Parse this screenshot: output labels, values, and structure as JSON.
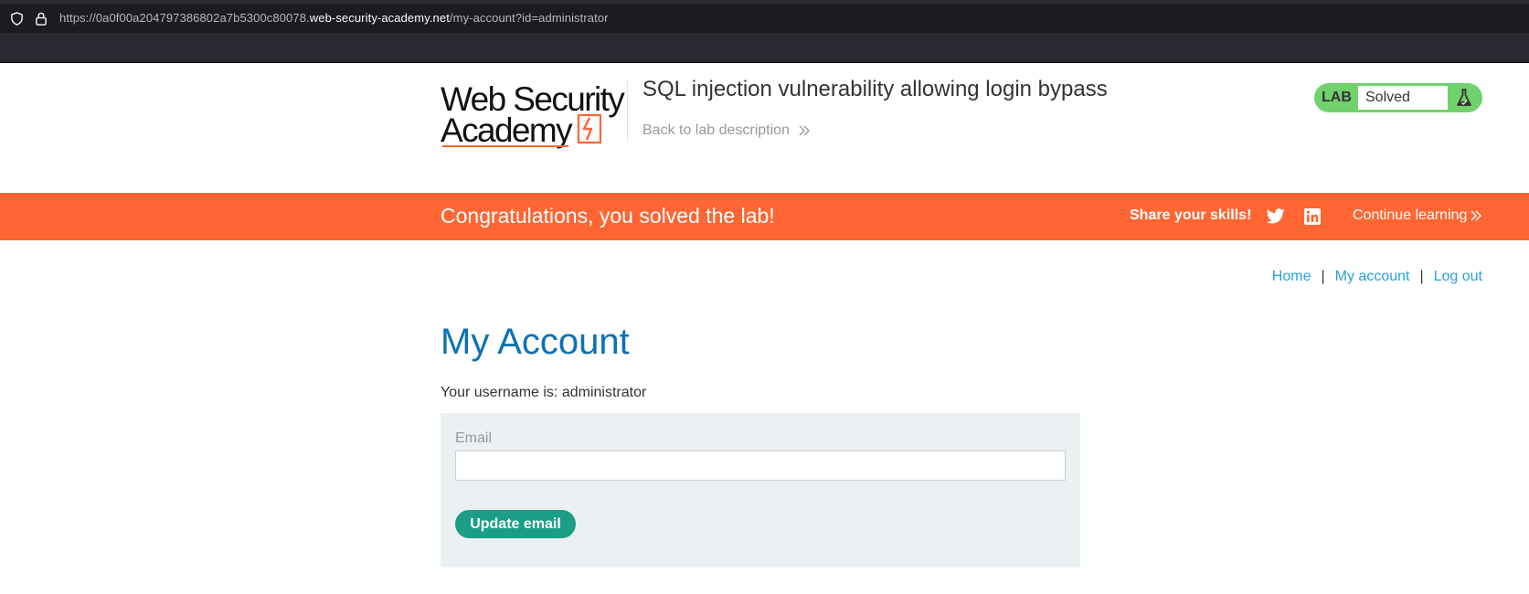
{
  "browser": {
    "url_prefix": "https://0a0f00a204797386802a7b5300c80078.",
    "url_host": "web-security-academy.net",
    "url_path": "/my-account?id=administrator"
  },
  "header": {
    "logo_line1": "Web Security",
    "logo_line2": "Academy",
    "lab_title": "SQL injection vulnerability allowing login bypass",
    "back_link": "Back to lab description",
    "lab_status_label": "LAB",
    "lab_status_value": "Solved"
  },
  "banner": {
    "message": "Congratulations, you solved the lab!",
    "share_label": "Share your skills!",
    "continue_label": "Continue learning"
  },
  "nav": {
    "home": "Home",
    "my_account": "My account",
    "log_out": "Log out",
    "separator": "|"
  },
  "main": {
    "title": "My Account",
    "username_text": "Your username is: administrator",
    "email_label": "Email",
    "email_value": "",
    "update_button": "Update email"
  },
  "colors": {
    "accent_orange": "#ff6633",
    "link_blue": "#29a0dd",
    "title_blue": "#0b71b7",
    "status_green": "#70d16d",
    "button_teal": "#1c9e86",
    "panel_bg": "#ebf0f2"
  },
  "icons": {
    "shield": "shield-icon",
    "lock": "lock-icon",
    "flask": "flask-icon",
    "twitter": "twitter-icon",
    "linkedin": "linkedin-icon",
    "chevron": "double-chevron-right-icon"
  }
}
